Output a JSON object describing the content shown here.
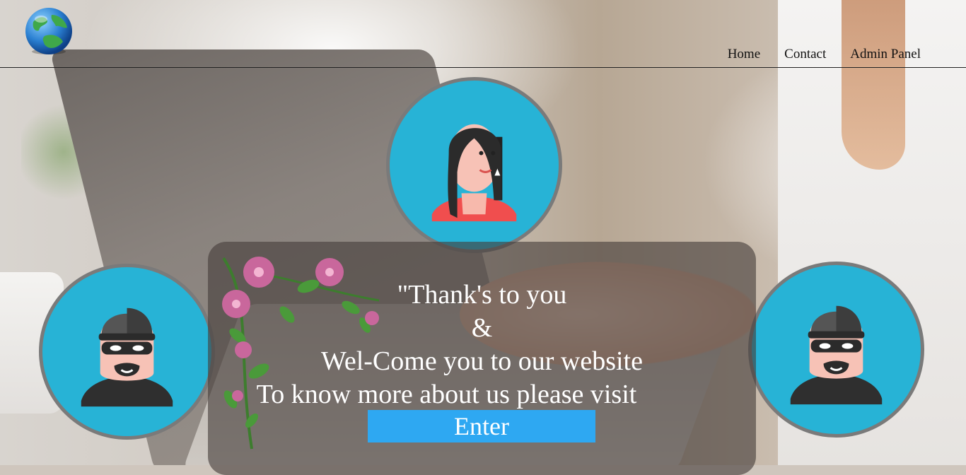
{
  "nav": {
    "home": "Home",
    "contact": "Contact",
    "admin": "Admin Panel"
  },
  "logo": {
    "icon": "globe-icon"
  },
  "avatars": {
    "top": "woman-avatar-icon",
    "left": "thief-avatar-icon",
    "right": "thief-avatar-icon"
  },
  "message": {
    "line1": "\"Thank's to you",
    "line2": "&",
    "line3": "Wel-Come you to our website",
    "line4": "To know more about us please visit"
  },
  "enter_button": "Enter",
  "colors": {
    "avatar_bg": "#27b3d6",
    "avatar_ring": "#7a7a7a",
    "button": "#2ea8f2"
  }
}
